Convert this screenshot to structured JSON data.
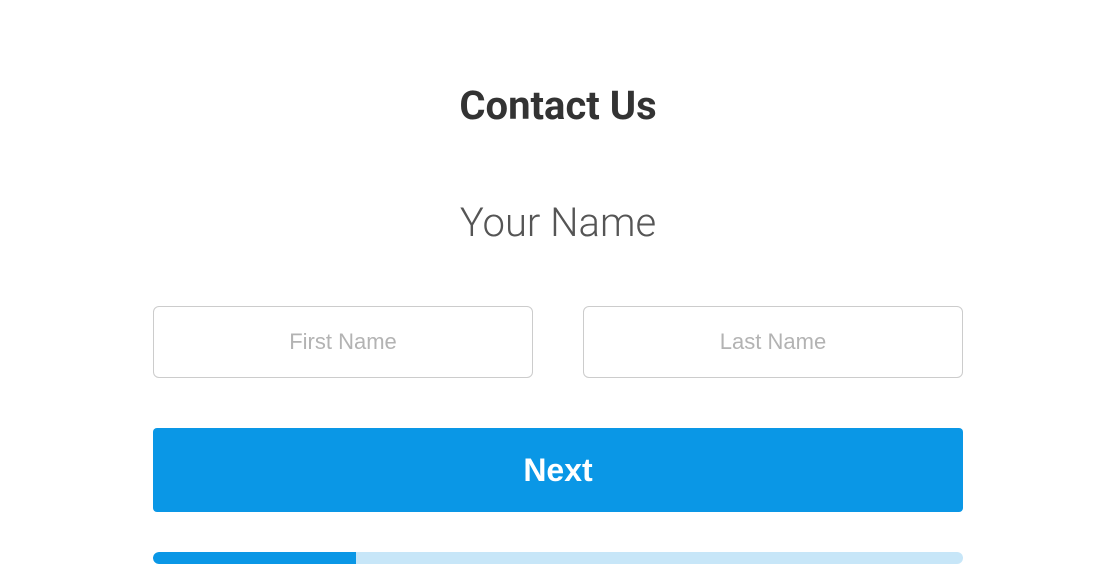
{
  "form": {
    "title": "Contact Us",
    "section_label": "Your Name",
    "first_name": {
      "placeholder": "First Name",
      "value": ""
    },
    "last_name": {
      "placeholder": "Last Name",
      "value": ""
    },
    "next_button_label": "Next",
    "progress_percent": 25
  }
}
